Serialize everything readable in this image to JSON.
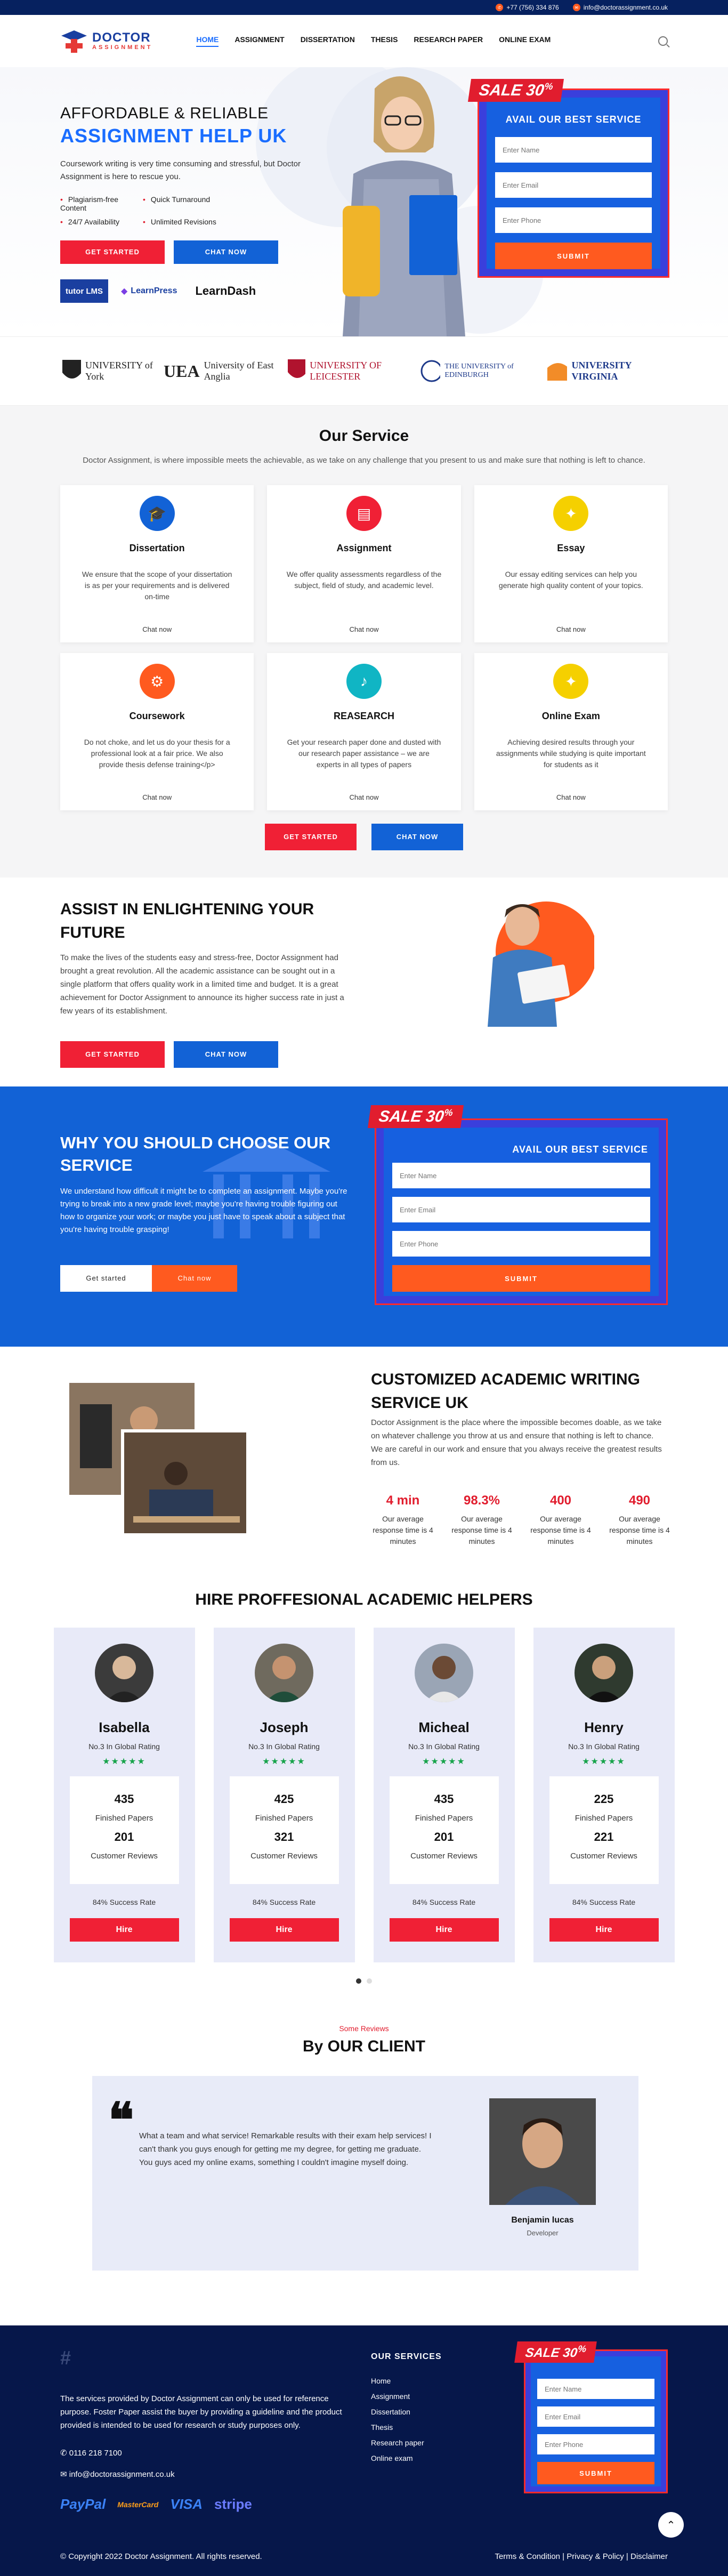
{
  "topbar": {
    "phone": "+77 (756) 334 876",
    "email": "info@doctorassignment.co.uk"
  },
  "brand": {
    "name": "DOCTOR",
    "sub": "ASSIGNMENT"
  },
  "nav": {
    "items": [
      "HOME",
      "ASSIGNMENT",
      "DISSERTATION",
      "THESIS",
      "RESEARCH PAPER",
      "ONLINE EXAM"
    ],
    "active": "HOME"
  },
  "hero": {
    "subtitle": "AFFORDABLE & RELIABLE",
    "title": "ASSIGNMENT HELP UK",
    "text": "Coursework writing is very time consuming and stressful, but Doctor Assignment is here to rescue you.",
    "features": [
      "Plagiarism-free Content",
      "Quick Turnaround",
      "24/7 Availability",
      "Unlimited Revisions"
    ],
    "btn_start": "GET STARTED",
    "btn_chat": "CHAT NOW",
    "partners": [
      "tutor LMS",
      "LearnPress",
      "LearnDash"
    ]
  },
  "form": {
    "sale": "SALE 30",
    "sale_pct": "%",
    "title": "AVAIL OUR BEST SERVICE",
    "name_ph": "Enter Name",
    "email_ph": "Enter Email",
    "phone_ph": "Enter Phone",
    "submit": "SUBMIT"
  },
  "universities": [
    {
      "name": "UNIVERSITY of York",
      "color": "#222"
    },
    {
      "name": "University of East Anglia",
      "color": "#111"
    },
    {
      "name": "UNIVERSITY OF LEICESTER",
      "color": "#b0132e"
    },
    {
      "name": "THE UNIVERSITY of EDINBURGH",
      "color": "#1e3a8a"
    },
    {
      "name": "UNIVERSITY VIRGINIA",
      "color": "#1e3a8a"
    }
  ],
  "services": {
    "title": "Our Service",
    "desc": "Doctor Assignment, is where impossible meets the achievable, as we take on any challenge that you present to us and make sure that nothing is left to chance.",
    "items": [
      {
        "title": "Dissertation",
        "text": "We ensure that the scope of your dissertation is as per your requirements and is delivered on-time",
        "chat": "Chat now",
        "color": "#1262d6",
        "icon": "graduation-cap-icon"
      },
      {
        "title": "Assignment",
        "text": "We offer quality assessments regardless of the subject, field of study, and academic level.",
        "chat": "Chat now",
        "color": "#f02035",
        "icon": "book-icon"
      },
      {
        "title": "Essay",
        "text": "Our essay editing services can help you generate high quality content of your topics.",
        "chat": "Chat now",
        "color": "#f5d000",
        "icon": "bulb-icon"
      },
      {
        "title": "Coursework",
        "text": "Do not choke, and let us do your thesis for a professional look at a fair price. We also provide thesis defense training</p>",
        "chat": "Chat now",
        "color": "#ff5a1f",
        "icon": "gear-icon"
      },
      {
        "title": "REASEARCH",
        "text": "Get your research paper done and dusted with our research paper assistance – we are experts in all types of papers",
        "chat": "Chat now",
        "color": "#10b5c4",
        "icon": "mic-icon"
      },
      {
        "title": "Online Exam",
        "text": "Achieving desired results through your assignments while studying is quite important for students as it",
        "chat": "Chat now",
        "color": "#f5d000",
        "icon": "bulb-icon"
      }
    ],
    "btn_start": "GET STARTED",
    "btn_chat": "CHAT NOW"
  },
  "assist": {
    "title": "ASSIST IN ENLIGHTENING YOUR FUTURE",
    "text": "To make the lives of the students easy and stress-free, Doctor Assignment had brought a great revolution. All the academic assistance can be sought out in a single platform that offers quality work in a limited time and budget. It is a great achievement for Doctor Assignment to announce its higher success rate in just a few years of its establishment.",
    "btn_start": "GET STARTED",
    "btn_chat": "CHAT NOW"
  },
  "why": {
    "title": "WHY YOU SHOULD CHOOSE OUR SERVICE",
    "text": "We understand how difficult it might be to complete an assignment. Maybe you're trying to break into a new grade level; maybe you're having trouble figuring out how to organize your work; or maybe you just have to speak about a subject that you're having trouble grasping!",
    "btn_start": "Get started",
    "btn_chat": "Chat now"
  },
  "custom": {
    "title": "CUSTOMIZED ACADEMIC WRITING SERVICE UK",
    "text": "Doctor Assignment is the place where the impossible becomes doable, as we take on whatever challenge you throw at us and ensure that nothing is left to chance. We are careful in our work and ensure that you always receive the greatest results from us.",
    "stats": [
      {
        "value": "4 min",
        "label": "Our average response time is 4 minutes"
      },
      {
        "value": "98.3%",
        "label": "Our average response time is 4 minutes"
      },
      {
        "value": "400",
        "label": "Our average response time is 4 minutes"
      },
      {
        "value": "490",
        "label": "Our average response time is 4 minutes"
      }
    ]
  },
  "helpers": {
    "title": "HIRE PROFFESIONAL ACADEMIC HELPERS",
    "people": [
      {
        "name": "Isabella",
        "rating": "No.3 In Global Rating",
        "stars": "★★★★★",
        "papers": "435",
        "papers_label": "Finished Papers",
        "reviews": "201",
        "reviews_label": "Customer Reviews",
        "success": "84% Success Rate",
        "hire": "Hire"
      },
      {
        "name": "Joseph",
        "rating": "No.3 In Global Rating",
        "stars": "★★★★★",
        "papers": "425",
        "papers_label": "Finished Papers",
        "reviews": "321",
        "reviews_label": "Customer Reviews",
        "success": "84% Success Rate",
        "hire": "Hire"
      },
      {
        "name": "Micheal",
        "rating": "No.3 In Global Rating",
        "stars": "★★★★★",
        "papers": "435",
        "papers_label": "Finished Papers",
        "reviews": "201",
        "reviews_label": "Customer Reviews",
        "success": "84% Success Rate",
        "hire": "Hire"
      },
      {
        "name": "Henry",
        "rating": "No.3 In Global Rating",
        "stars": "★★★★★",
        "papers": "225",
        "papers_label": "Finished Papers",
        "reviews": "221",
        "reviews_label": "Customer Reviews",
        "success": "84% Success Rate",
        "hire": "Hire"
      }
    ]
  },
  "reviews": {
    "tag": "Some Reviews",
    "title": "By OUR CLIENT",
    "text": "What a team and what service! Remarkable results with their exam help services! I can't thank you guys enough for getting me my degree, for getting me graduate. You guys aced my online exams, something I couldn't imagine myself doing.",
    "name": "Benjamin lucas",
    "role": "Developer"
  },
  "footer": {
    "about": "The services provided by Doctor Assignment can only be used for reference purpose. Foster Paper assist the buyer by providing a guideline and the product provided is intended to be used for research or study purposes only.",
    "phone": "0116 218 7100",
    "email": "info@doctorassignment.co.uk",
    "payments": [
      "PayPal",
      "MasterCard",
      "VISA",
      "stripe"
    ],
    "services_title": "OUR SERVICES",
    "services": [
      "Home",
      "Assignment",
      "Dissertation",
      "Thesis",
      "Research paper",
      "Online exam"
    ],
    "copyright": "© Copyright 2022 Doctor Assignment. All rights reserved.",
    "links": "Terms & Condition | Privacy & Policy | Disclaimer"
  }
}
